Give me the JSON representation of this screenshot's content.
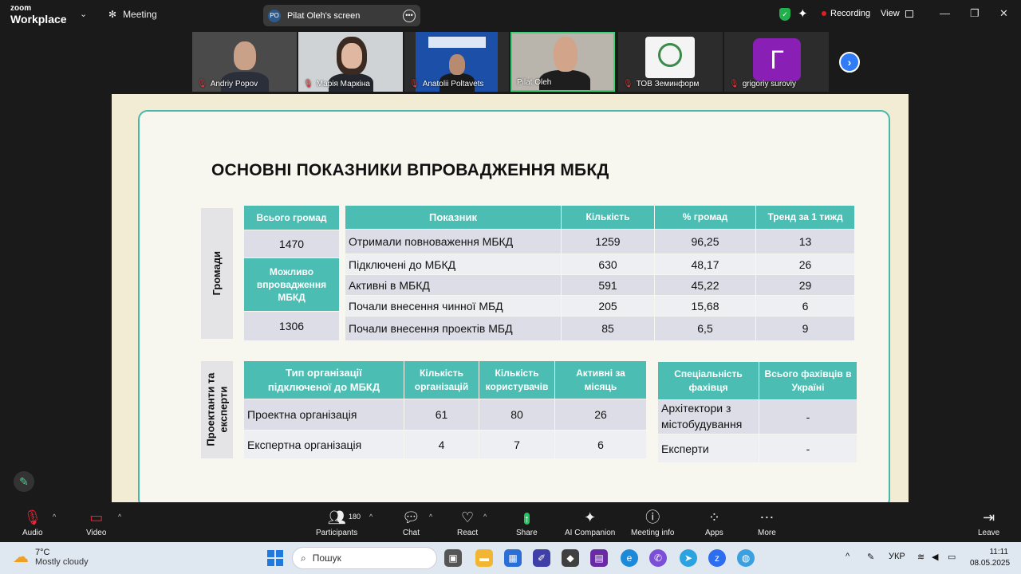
{
  "titlebar": {
    "logo_top": "zoom",
    "logo_bottom": "Workplace",
    "meeting_tab": "Meeting",
    "screen_initials": "PO",
    "screen_label": "Pilat Oleh's screen",
    "recording": "Recording",
    "view": "View"
  },
  "participants": [
    {
      "name": "Andriy Popov",
      "muted": true
    },
    {
      "name": "Марія Маркіна",
      "muted": true
    },
    {
      "name": "Anatolii Poltavets",
      "muted": true
    },
    {
      "name": "Pilat Oleh",
      "muted": false,
      "active": true
    },
    {
      "name": "ТОВ Земинформ",
      "muted": true
    },
    {
      "name": "grigoriy suroviy",
      "muted": true,
      "avatar_letter": "Г"
    }
  ],
  "slide": {
    "title": "ОСНОВНІ ПОКАЗНИКИ ВПРОВАДЖЕННЯ МБКД",
    "section1_label": "Громади",
    "total_header": "Всього громад",
    "total_value": "1470",
    "possible_header": "Можливо впровадження МБКД",
    "possible_value": "1306",
    "table1": {
      "headers": [
        "Показник",
        "Кількість",
        "% громад",
        "Тренд за 1 тижд"
      ],
      "rows": [
        [
          "Отримали повноваження МБКД",
          "1259",
          "96,25",
          "13"
        ],
        [
          "Підключені до МБКД",
          "630",
          "48,17",
          "26"
        ],
        [
          "Активні в МБКД",
          "591",
          "45,22",
          "29"
        ],
        [
          "Почали внесення чинної МБД",
          "205",
          "15,68",
          "6"
        ],
        [
          "Почали внесення проектів МБД",
          "85",
          "6,5",
          "9"
        ]
      ]
    },
    "section2_label_line1": "Проектанти та",
    "section2_label_line2": "експерти",
    "table2": {
      "headers": [
        "Тип організації підключеної до МБКД",
        "Кількість організацій",
        "Кількість користувачів",
        "Активні за місяць"
      ],
      "rows": [
        [
          "Проектна організація",
          "61",
          "80",
          "26"
        ],
        [
          "Експертна організація",
          "4",
          "7",
          "6"
        ]
      ]
    },
    "table3": {
      "headers": [
        "Спеціальність фахівця",
        "Всього фахівців в Україні"
      ],
      "rows": [
        [
          "Архітектори з містобудування",
          "-"
        ],
        [
          "Експерти",
          "-"
        ]
      ]
    }
  },
  "toolbar": {
    "audio": "Audio",
    "video": "Video",
    "participants": "Participants",
    "participants_count": "180",
    "chat": "Chat",
    "react": "React",
    "share": "Share",
    "ai_companion": "AI Companion",
    "meeting_info": "Meeting info",
    "apps": "Apps",
    "more": "More",
    "leave": "Leave"
  },
  "taskbar": {
    "temperature": "7°C",
    "weather": "Mostly cloudy",
    "search_placeholder": "Пошук",
    "language": "УКР",
    "time": "11:11",
    "date": "08.05.2025"
  },
  "colors": {
    "accent_teal": "#4bbdb2",
    "active_green": "#3cd27a",
    "record_red": "#e02020",
    "row_dark": "#dcdde7",
    "row_light": "#eeeff3"
  }
}
